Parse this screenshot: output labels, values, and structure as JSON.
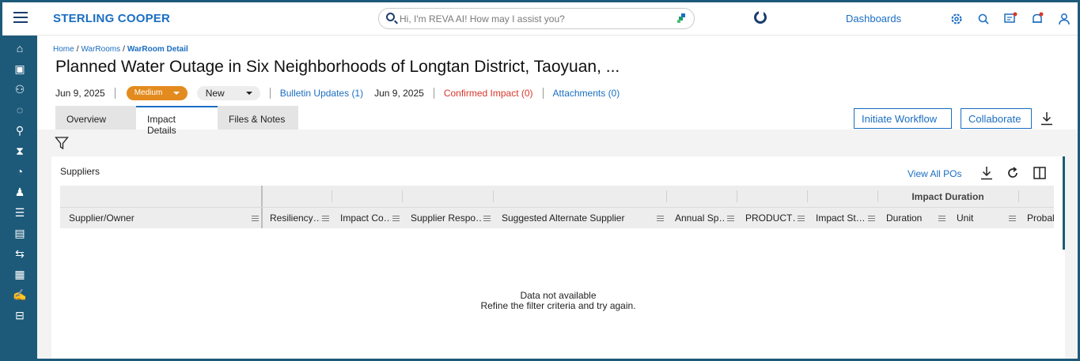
{
  "app": {
    "brand": "STERLING COOPER",
    "search_placeholder": "Hi, I'm REVA AI! How may I assist you?",
    "dashboards_label": "Dashboards"
  },
  "breadcrumb": {
    "home": "Home",
    "warrooms": "WarRooms",
    "current": "WarRoom Detail"
  },
  "page": {
    "title": "Planned Water Outage in Six Neighborhoods of Longtan District, Taoyuan, ...",
    "date": "Jun 9, 2025",
    "severity": "Medium",
    "status": "New",
    "bulletin_updates": "Bulletin Updates (1)",
    "bulletin_date": "Jun 9, 2025",
    "confirmed_impact": "Confirmed Impact (0)",
    "attachments": "Attachments (0)"
  },
  "tabs": [
    {
      "label": "Overview",
      "active": false
    },
    {
      "label": "Impact Details",
      "active": true
    },
    {
      "label": "Files & Notes",
      "active": false
    }
  ],
  "actions": {
    "initiate_workflow": "Initiate Workflow",
    "collaborate": "Collaborate"
  },
  "suppliers": {
    "title": "Suppliers",
    "view_all_pos": "View All POs",
    "group_header": "Impact Duration",
    "columns": [
      "Supplier/Owner",
      "Resiliency…",
      "Impact Co…",
      "Supplier Respo…",
      "Suggested Alternate Supplier",
      "Annual Sp…",
      "PRODUCT…",
      "Impact St…",
      "Duration",
      "Unit",
      "Probal"
    ],
    "empty_line1": "Data not available",
    "empty_line2": "Refine the filter criteria and try again."
  },
  "colors": {
    "brand_blue": "#1b6ec2",
    "sidebar": "#1d5a7a",
    "medium_badge": "#e38b1e",
    "confirmed_red": "#d9362b"
  },
  "icons": {
    "sidebar": [
      "home-icon",
      "calendar-icon",
      "org-chart-icon",
      "cycle-icon",
      "search-user-icon",
      "hourglass-icon",
      "speedometer-icon",
      "user-gear-icon",
      "list-icon",
      "clipboard-icon",
      "transfer-icon",
      "new-grid-icon",
      "hand-coins-icon",
      "stack-icon"
    ],
    "topbar": [
      "gear-icon",
      "search-icon",
      "chat-alert-icon",
      "bell-icon",
      "user-icon"
    ]
  }
}
